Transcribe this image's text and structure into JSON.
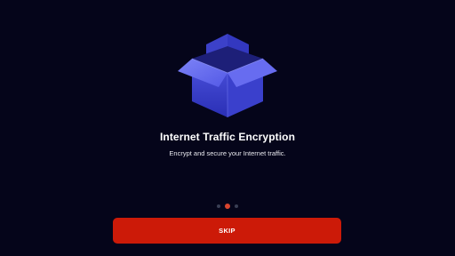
{
  "onboarding": {
    "title": "Internet Traffic Encryption",
    "subtitle": "Encrypt and secure your Internet traffic.",
    "illustration": "open-box-icon",
    "pager": {
      "total": 3,
      "active_index": 1
    },
    "skip_label": "SKIP"
  },
  "colors": {
    "background": "#05051a",
    "box_light": "#6f74f2",
    "box_dark": "#2b30b8",
    "dot_active": "#d9442e",
    "dot_inactive": "#3a3f55",
    "button": "#cc1a08"
  }
}
